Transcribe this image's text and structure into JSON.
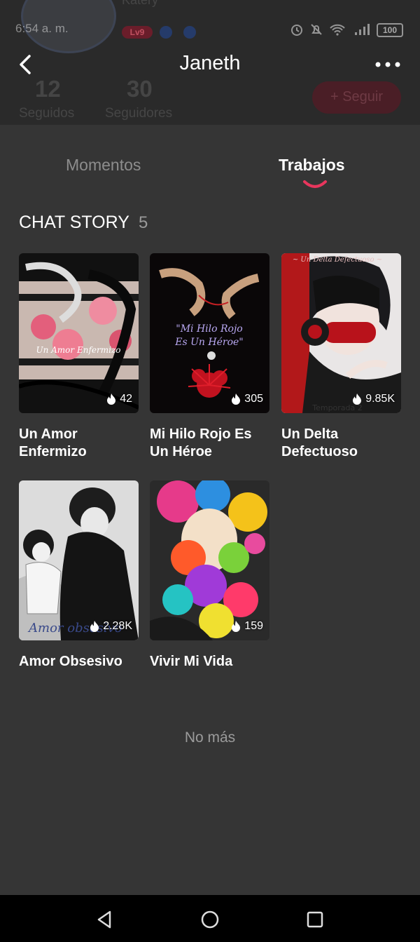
{
  "status_bar": {
    "time": "6:54 a. m.",
    "battery": "100"
  },
  "profile": {
    "name": "Janeth",
    "username_background": "Katery",
    "level_badge": "Lv9",
    "following_count": "12",
    "following_label": "Seguidos",
    "followers_count": "30",
    "followers_label": "Seguidores",
    "follow_button": "+ Seguir"
  },
  "tabs": [
    {
      "label": "Momentos",
      "active": false
    },
    {
      "label": "Trabajos",
      "active": true
    }
  ],
  "section": {
    "title": "CHAT STORY",
    "count": "5"
  },
  "stories": [
    {
      "title": "Un Amor Enfermizo",
      "heat": "42"
    },
    {
      "title": "Mi Hilo Rojo Es Un Héroe",
      "heat": "305"
    },
    {
      "title": "Un Delta Defectuoso",
      "heat": "9.85K"
    },
    {
      "title": "Amor Obsesivo",
      "heat": "2.28K"
    },
    {
      "title": "Vivir Mi Vida",
      "heat": "159"
    }
  ],
  "footer": {
    "no_more": "No más"
  },
  "colors": {
    "background": "#353535",
    "accent": "#e8365d",
    "header": "#2a2a2a"
  }
}
